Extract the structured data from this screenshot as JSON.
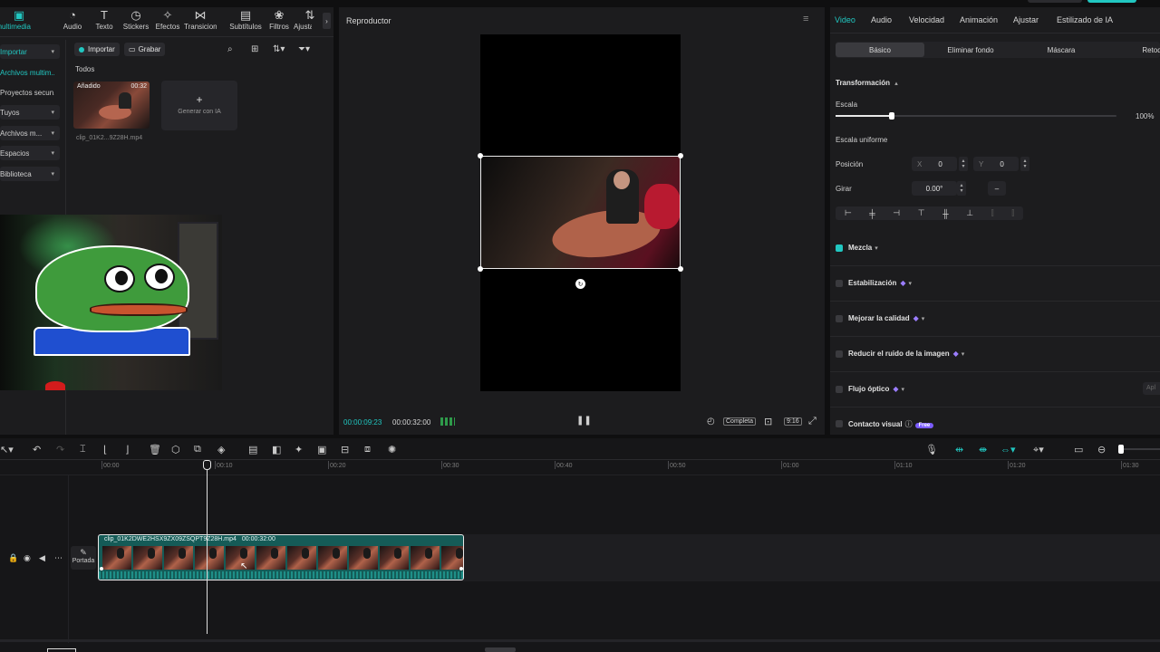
{
  "media_tabs": [
    {
      "label": "Archivos multimedia",
      "icon": "media-icon",
      "glyph": "▣",
      "active": true
    },
    {
      "label": "Audio",
      "icon": "audio-icon",
      "glyph": "◔"
    },
    {
      "label": "Texto",
      "icon": "text-icon",
      "glyph": "T"
    },
    {
      "label": "Stickers",
      "icon": "sticker-icon",
      "glyph": "◷"
    },
    {
      "label": "Efectos",
      "icon": "effects-icon",
      "glyph": "✧"
    },
    {
      "label": "Transiciones",
      "icon": "transition-icon",
      "glyph": "⋈"
    },
    {
      "label": "Subtítulos",
      "icon": "subtitle-icon",
      "glyph": "▤"
    },
    {
      "label": "Filtros",
      "icon": "filter-icon",
      "glyph": "❀"
    },
    {
      "label": "Ajustar",
      "icon": "adjust-icon",
      "glyph": "⇅"
    }
  ],
  "sidebar": {
    "items": [
      {
        "label": "Importar",
        "active": true,
        "boxed": true,
        "caret": "▾"
      },
      {
        "label": "Archivos multim...",
        "active": true
      },
      {
        "label": "Proyectos secun..."
      },
      {
        "label": "Tuyos",
        "boxed": true,
        "caret": "▾"
      },
      {
        "label": "Archivos m...",
        "boxed": true,
        "caret": "▾"
      },
      {
        "label": "Espacios",
        "boxed": true,
        "caret": "▾"
      },
      {
        "label": "Biblioteca",
        "boxed": true,
        "caret": "▾"
      }
    ]
  },
  "media": {
    "import_label": "Importar",
    "record_label": "Grabar",
    "filter_heading": "Todos",
    "clip": {
      "badge": "Añadido",
      "duration": "00:32",
      "filename": "clip_01K2...9Z28H.mp4"
    },
    "generate_label": "Generar con IA"
  },
  "player": {
    "title": "Reproductor",
    "current_time": "00:00:09:23",
    "total_time": "00:00:32:00",
    "quality_label": "Completa",
    "ratio_label": "9:16"
  },
  "right_panel": {
    "tabs": [
      "Video",
      "Audio",
      "Velocidad",
      "Animación",
      "Ajustar",
      "Estilizado de IA"
    ],
    "subtabs": [
      "Básico",
      "Eliminar fondo",
      "Máscara",
      "Retoq"
    ],
    "section_title": "Transformación",
    "scale_label": "Escala",
    "scale_value": "100%",
    "scale_level": 0.2,
    "uniform_label": "Escala uniforme",
    "position_label": "Posición",
    "pos_x_label": "X",
    "pos_x": "0",
    "pos_y_label": "Y",
    "pos_y": "0",
    "rotate_label": "Girar",
    "rotate_value": "0.00°",
    "rotate_extra": "–",
    "sections": [
      {
        "label": "Mezcla",
        "checked": true,
        "gem": false
      },
      {
        "label": "Estabilización",
        "checked": false,
        "gem": true
      },
      {
        "label": "Mejorar la calidad",
        "checked": false,
        "gem": true
      },
      {
        "label": "Reducir el ruido de la imagen",
        "checked": false,
        "gem": true
      },
      {
        "label": "Flujo óptico",
        "checked": false,
        "gem": true
      },
      {
        "label": "Contacto visual",
        "checked": false,
        "gem": false,
        "badge": "Free"
      }
    ],
    "apply_label": "Apl"
  },
  "timeline": {
    "ticks": [
      "00:00",
      "00:10",
      "00:20",
      "00:30",
      "00:40",
      "00:50",
      "01:00",
      "01:10",
      "01:20",
      "01:30"
    ],
    "clip_label": "clip_01K2DWE2HSX9ZX09ZSQPT9Z28H.mp4",
    "clip_duration": "00:00:32:00",
    "cover_label": "Portada"
  },
  "colors": {
    "accent": "#21c7c1",
    "clip": "#155b57",
    "gem": "#9b7dff"
  }
}
